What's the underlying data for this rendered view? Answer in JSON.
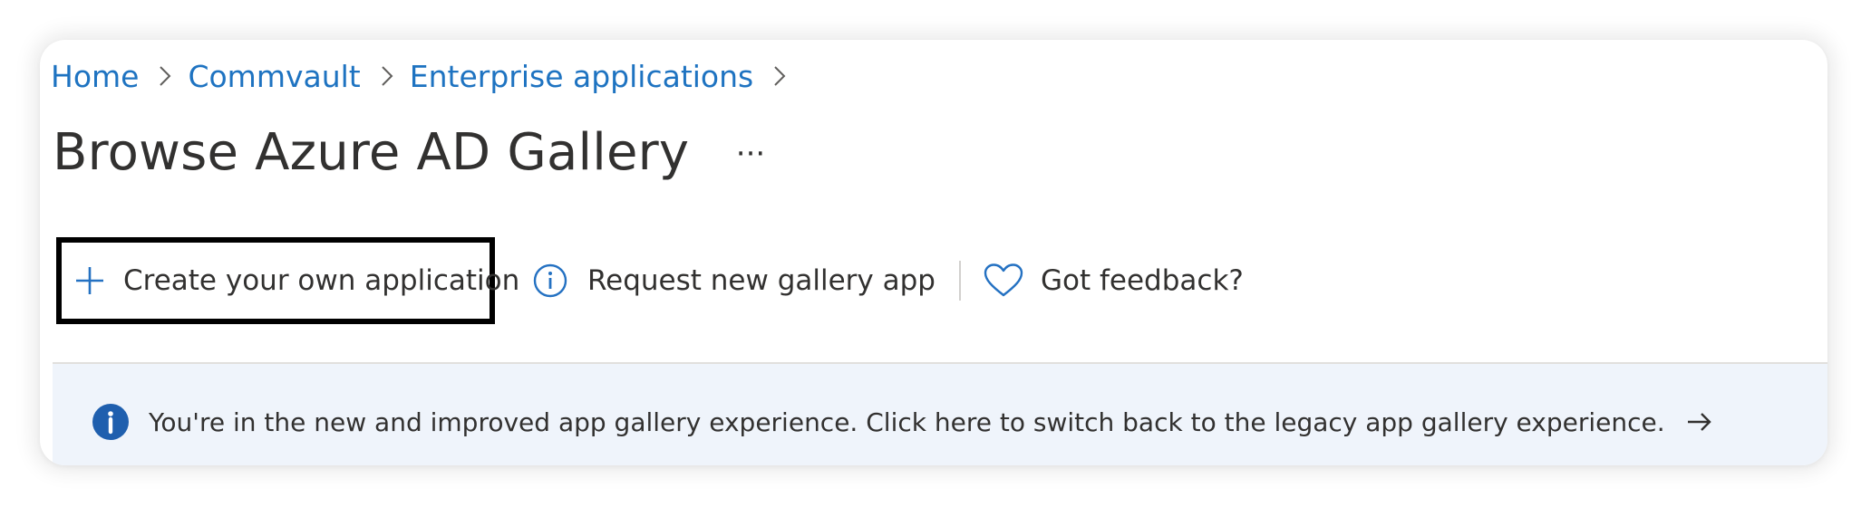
{
  "breadcrumb": {
    "items": [
      {
        "label": "Home"
      },
      {
        "label": "Commvault"
      },
      {
        "label": "Enterprise applications"
      }
    ]
  },
  "page": {
    "title": "Browse Azure AD Gallery",
    "more_label": "···"
  },
  "toolbar": {
    "create_label": "Create your own application",
    "request_label": "Request new gallery app",
    "feedback_label": "Got feedback?"
  },
  "banner": {
    "text": "You're in the new and improved app gallery experience. Click here to switch back to the legacy app gallery experience."
  },
  "colors": {
    "link_blue": "#1e73c1",
    "icon_blue": "#2471c2",
    "info_blue": "#1f5fae",
    "banner_bg": "#eff4fb",
    "text": "#323130"
  },
  "icons": {
    "create": "plus-icon",
    "request": "info-circle-icon",
    "feedback": "heart-icon",
    "banner": "info-filled-icon",
    "banner_arrow": "arrow-right-icon",
    "breadcrumb_separator": "chevron-right-icon"
  }
}
